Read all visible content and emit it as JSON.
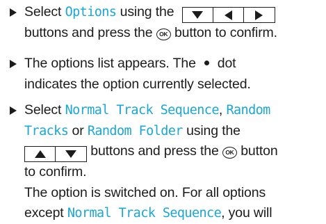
{
  "step1": {
    "line1_prefix": "Select ",
    "line1_keyword": "Options",
    "line1_suffix": " using the",
    "line2_prefix": "buttons and press the ",
    "ok_label": "OK",
    "line2_suffix": " button to confirm."
  },
  "step2": {
    "line1_prefix": "The options list appears. The",
    "line1_suffix": "dot",
    "line2": "indicates the option currently selected."
  },
  "step3": {
    "line1_prefix": "Select ",
    "kw_normal": "Normal Track Sequence",
    "comma": ",",
    "kw_random_tracks_a": "Random",
    "kw_random_tracks_b": "Tracks",
    "or_text": " or ",
    "kw_random_folder": "Random Folder",
    "using_the": " using the",
    "line4_middle": " buttons and press the ",
    "ok_label": "OK",
    "line4_suffix": " button",
    "line5": "to confirm.",
    "line6": "The option is switched on. For all options",
    "line7_prefix": "except ",
    "kw_normal_2": "Normal Track Sequence",
    "line7_suffix": ", you will"
  },
  "colors": {
    "keyword": "#1aa6d6",
    "text": "#1c1c1c"
  }
}
